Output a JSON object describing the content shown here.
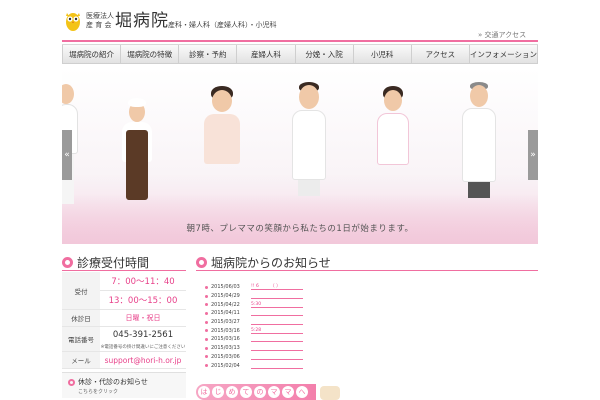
{
  "header": {
    "corp_label_1": "医療法人",
    "corp_label_2": "産 育 会",
    "hospital_name": "堀病院",
    "departments": "産科・婦人科（産婦人科）・小児科",
    "access_link": "» 交通アクセス"
  },
  "nav": {
    "items": [
      "堀病院の紹介",
      "堀病院の特徴",
      "診察・予約",
      "産婦人科",
      "分娩・入院",
      "小児科",
      "アクセス",
      "インフォメーション"
    ]
  },
  "hero": {
    "caption": "朝7時、プレママの笑顔から私たちの1日が始まります。",
    "prev_glyph": "«",
    "next_glyph": "»"
  },
  "hours": {
    "title": "診療受付時間",
    "reception_label": "受付",
    "morning": "7：00〜11：40",
    "afternoon": "13：00〜15：00",
    "holiday_label": "休診日",
    "holiday_value": "日曜・祝日",
    "phone_label": "電話番号",
    "phone_value": "045-391-2561",
    "phone_note": "※電話番号の掛け間違いにご注意ください",
    "mail_label": "メール",
    "mail_value": "support@hori-h.or.jp"
  },
  "notice": {
    "title": "休診・代診のお知らせ",
    "sub": "こちらをクリック"
  },
  "news": {
    "title": "堀病院からのお知らせ",
    "items": [
      {
        "date": "2015/06/03",
        "link": "!! 6　　　（ ）"
      },
      {
        "date": "2015/04/29",
        "link": ""
      },
      {
        "date": "2015/04/22",
        "link": "5:30"
      },
      {
        "date": "2015/04/11",
        "link": ""
      },
      {
        "date": "2015/03/27",
        "link": ""
      },
      {
        "date": "2015/03/16",
        "link": "5:28"
      },
      {
        "date": "2015/03/16",
        "link": ""
      },
      {
        "date": "2015/03/13",
        "link": ""
      },
      {
        "date": "2015/03/06",
        "link": ""
      },
      {
        "date": "2015/02/04",
        "link": ""
      }
    ]
  },
  "banner": {
    "chars": [
      "は",
      "じ",
      "め",
      "て",
      "の",
      "マ",
      "マ",
      "へ"
    ]
  },
  "colors": {
    "accent_pink": "#f06ea0",
    "text_pink": "#e8418a"
  }
}
